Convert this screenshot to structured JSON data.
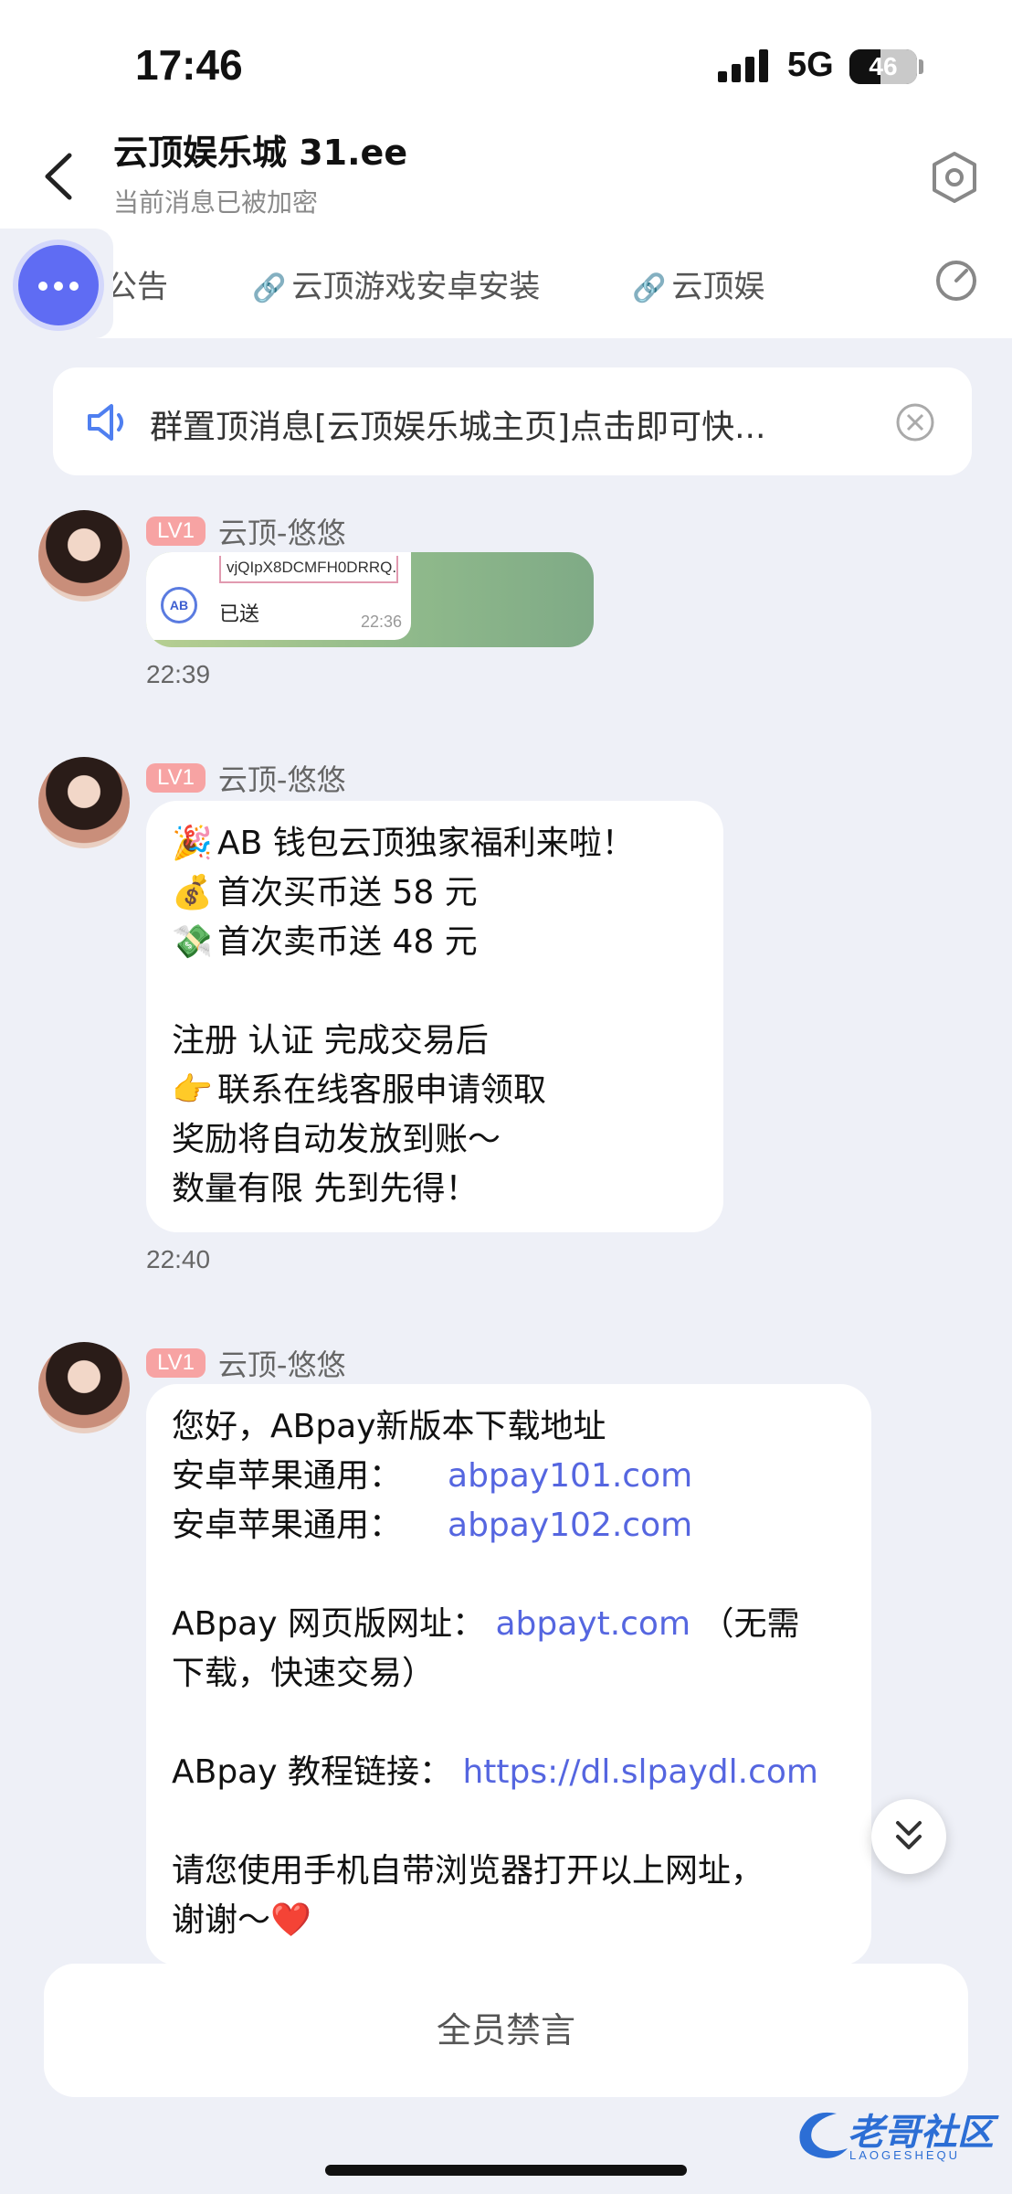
{
  "status_bar": {
    "time": "17:46",
    "network": "5G",
    "battery_level": "46",
    "battery_fraction": 0.46
  },
  "header": {
    "title": "云顶娱乐城 31.ee",
    "subtitle": "当前消息已被加密"
  },
  "tabs": [
    {
      "label": "公告",
      "has_link_icon": false
    },
    {
      "label": "云顶游戏安卓安装",
      "has_link_icon": true
    },
    {
      "label": "云顶娱",
      "has_link_icon": true
    }
  ],
  "pinned": {
    "text": "群置顶消息[云顶娱乐城主页]点击即可快..."
  },
  "messages": [
    {
      "level": "LV1",
      "sender": "云顶-悠悠",
      "type": "image",
      "image": {
        "reference": "vjQIpX8DCMFH0DRRQ...",
        "status": "已送",
        "time": "22:36",
        "logo_text": "AB"
      },
      "time": "22:39"
    },
    {
      "level": "LV1",
      "sender": "云顶-悠悠",
      "type": "text",
      "lines": [
        {
          "emoji": "🎉",
          "text": "AB 钱包云顶独家福利来啦！"
        },
        {
          "emoji": "💰",
          "text": "首次买币送 58 元"
        },
        {
          "emoji": "💸",
          "text": "首次卖币送 48 元"
        },
        {
          "text": ""
        },
        {
          "text": "注册 认证 完成交易后"
        },
        {
          "emoji": "👉",
          "text": "联系在线客服申请领取"
        },
        {
          "text": "奖励将自动发放到账～"
        },
        {
          "text": "数量有限 先到先得！"
        }
      ],
      "time": "22:40"
    },
    {
      "level": "LV1",
      "sender": "云顶-悠悠",
      "type": "text",
      "content": {
        "greeting": "您好，ABpay新版本下载地址",
        "row1_label": "安卓苹果通用：",
        "row1_link": "abpay101.com",
        "row2_label": "安卓苹果通用：",
        "row2_link": "abpay102.com",
        "web_label": "ABpay 网页版网址：",
        "web_link": "abpayt.com",
        "web_note_a": "（无需",
        "web_note_b": "下载，快速交易）",
        "tutorial_label": "ABpay 教程链接：",
        "tutorial_link": "https://dl.slpaydl.com",
        "closing_a": "请您使用手机自带浏览器打开以上网址，",
        "closing_b": "谢谢～",
        "closing_emoji": "❤️"
      }
    }
  ],
  "mute_bar": {
    "label": "全员禁言"
  },
  "watermark": {
    "main": "老哥社区",
    "sub": "LAOGESHEQU"
  }
}
